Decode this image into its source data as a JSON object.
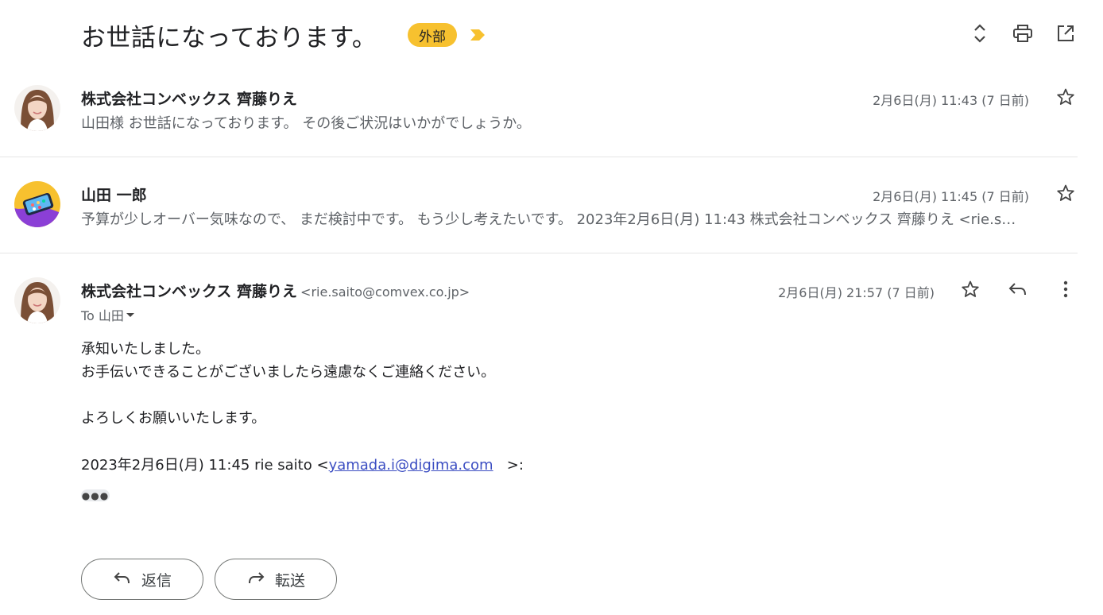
{
  "thread": {
    "subject": "お世話になっております。",
    "label": "外部"
  },
  "toolbar": {
    "expand_icon": "unfold-icon",
    "print_icon": "print-icon",
    "popout_icon": "open-in-new-window-icon"
  },
  "messages": [
    {
      "sender": "株式会社コンベックス 齊藤りえ",
      "date": "2月6日(月) 11:43 (7 日前)",
      "snippet": "山田様 お世話になっております。 その後ご状況はいかがでしょうか。"
    },
    {
      "sender": "山田 一郎",
      "date": "2月6日(月) 11:45 (7 日前)",
      "snippet": "予算が少しオーバー気味なので、 まだ検討中です。 もう少し考えたいです。 2023年2月6日(月) 11:43 株式会社コンベックス 齊藤りえ <rie.s…"
    },
    {
      "sender": "株式会社コンベックス 齊藤りえ",
      "email": "<rie.saito@comvex.co.jp>",
      "date": "2月6日(月) 21:57 (7 日前)",
      "to_label": "To 山田",
      "body": {
        "line1": "承知いたしました。",
        "line2": "お手伝いできることがございましたら遠慮なくご連絡ください。",
        "line3": "よろしくお願いいたします。",
        "quote_prefix": "2023年2月6日(月) 11:45 rie saito <",
        "quote_link": "yamada.i@digima.com",
        "quote_suffix": ">:"
      }
    }
  ],
  "actions": {
    "reply_label": "返信",
    "forward_label": "転送"
  },
  "colors": {
    "label_bg": "#f7c12f",
    "important_marker": "#f7c12f",
    "link": "#3c4ec2"
  }
}
